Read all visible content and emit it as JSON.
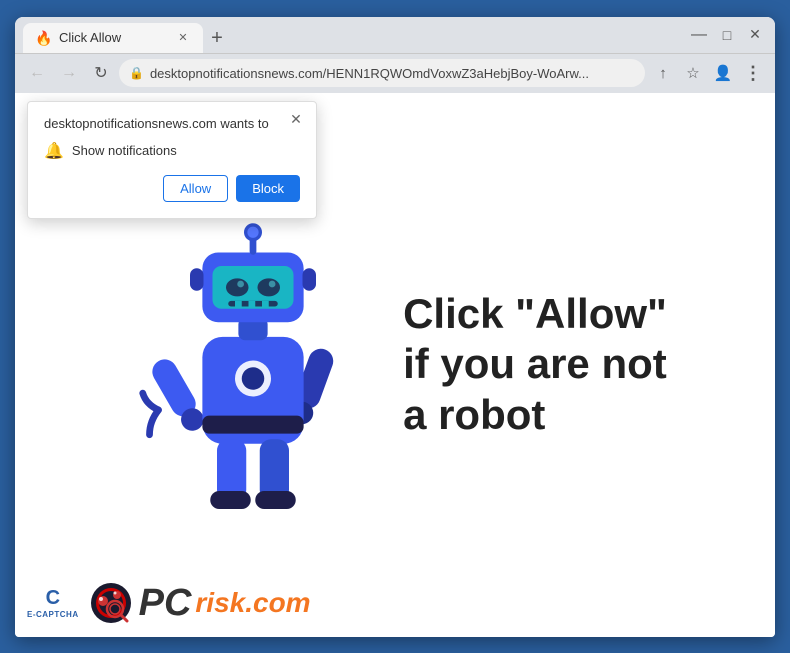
{
  "window": {
    "title": "Click Allow",
    "tab_label": "Click Allow",
    "new_tab_symbol": "+",
    "minimize_symbol": "—",
    "maximize_symbol": "□",
    "close_symbol": "✕"
  },
  "addressbar": {
    "url": "desktopnotificationsnews.com/HENN1RQWOmdVoxwZ3aHebjBoy-WoArw...",
    "back_symbol": "←",
    "forward_symbol": "→",
    "reload_symbol": "↻",
    "lock_symbol": "🔒",
    "share_symbol": "↑",
    "bookmark_symbol": "☆",
    "profile_symbol": "👤",
    "menu_symbol": "⋮"
  },
  "popup": {
    "title": "desktopnotificationsnews.com wants to",
    "notification_text": "Show notifications",
    "bell_symbol": "🔔",
    "close_symbol": "✕",
    "allow_label": "Allow",
    "block_label": "Block"
  },
  "page": {
    "click_text_line1": "Click \"Allow\"",
    "click_text_line2": "if you are not",
    "click_text_line3": "a robot"
  },
  "watermark": {
    "pc_text": "PC",
    "risk_text": "risk.com",
    "ecaptcha_text": "E-CAPTCHA",
    "ecaptcha_c": "C"
  },
  "colors": {
    "accent_blue": "#1a73e8",
    "robot_blue": "#3d5af1",
    "robot_dark": "#2a3fa0",
    "robot_teal": "#1ab5c4",
    "pcrisk_orange": "#f47621",
    "pcrisk_dark": "#333333"
  }
}
